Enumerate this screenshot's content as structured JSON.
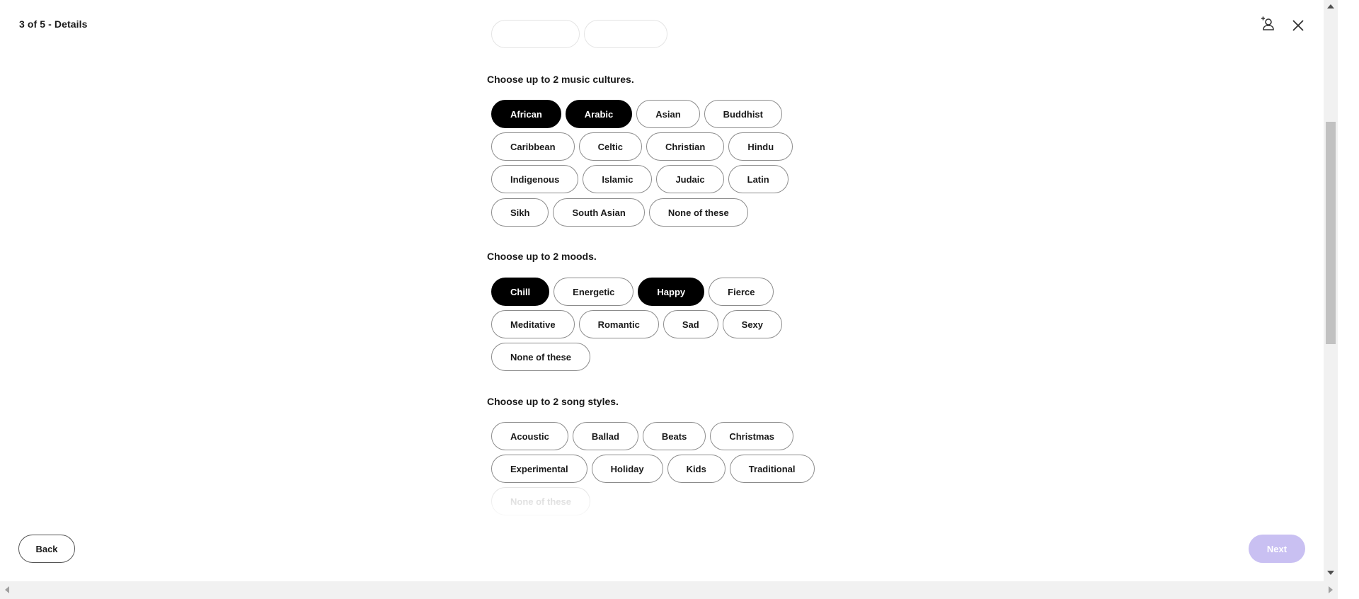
{
  "header": {
    "step_title": "3 of 5 - Details",
    "add_collaborator_icon": "add-person-icon",
    "close_icon": "close-icon"
  },
  "music_cultures": {
    "label": "Choose up to 2 music cultures.",
    "options": [
      {
        "label": "African",
        "selected": true
      },
      {
        "label": "Arabic",
        "selected": true
      },
      {
        "label": "Asian",
        "selected": false
      },
      {
        "label": "Buddhist",
        "selected": false
      },
      {
        "label": "Caribbean",
        "selected": false
      },
      {
        "label": "Celtic",
        "selected": false
      },
      {
        "label": "Christian",
        "selected": false
      },
      {
        "label": "Hindu",
        "selected": false
      },
      {
        "label": "Indigenous",
        "selected": false
      },
      {
        "label": "Islamic",
        "selected": false
      },
      {
        "label": "Judaic",
        "selected": false
      },
      {
        "label": "Latin",
        "selected": false
      },
      {
        "label": "Sikh",
        "selected": false
      },
      {
        "label": "South Asian",
        "selected": false
      },
      {
        "label": "None of these",
        "selected": false
      }
    ]
  },
  "moods": {
    "label": "Choose up to 2 moods.",
    "options": [
      {
        "label": "Chill",
        "selected": true
      },
      {
        "label": "Energetic",
        "selected": false
      },
      {
        "label": "Happy",
        "selected": true
      },
      {
        "label": "Fierce",
        "selected": false
      },
      {
        "label": "Meditative",
        "selected": false
      },
      {
        "label": "Romantic",
        "selected": false
      },
      {
        "label": "Sad",
        "selected": false
      },
      {
        "label": "Sexy",
        "selected": false
      },
      {
        "label": "None of these",
        "selected": false
      }
    ]
  },
  "song_styles": {
    "label": "Choose up to 2 song styles.",
    "options": [
      {
        "label": "Acoustic",
        "selected": false
      },
      {
        "label": "Ballad",
        "selected": false
      },
      {
        "label": "Beats",
        "selected": false
      },
      {
        "label": "Christmas",
        "selected": false
      },
      {
        "label": "Experimental",
        "selected": false
      },
      {
        "label": "Holiday",
        "selected": false
      },
      {
        "label": "Kids",
        "selected": false
      },
      {
        "label": "Traditional",
        "selected": false
      },
      {
        "label": "None of these",
        "selected": false
      }
    ]
  },
  "footer": {
    "back_label": "Back",
    "next_label": "Next",
    "next_color": "#c9c0f2"
  }
}
